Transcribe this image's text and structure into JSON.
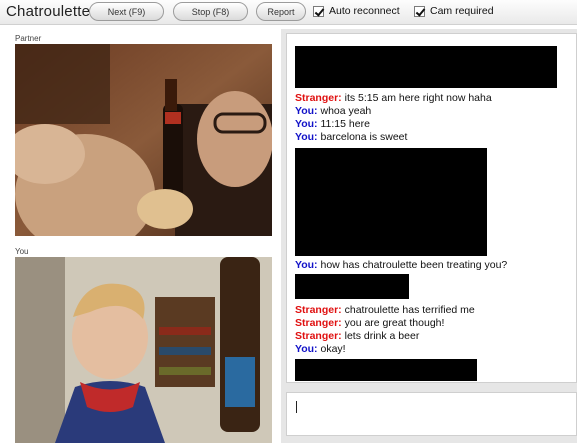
{
  "app": {
    "title": "Chatroulette"
  },
  "toolbar": {
    "next_label": "Next (F9)",
    "stop_label": "Stop (F8)",
    "report_label": "Report",
    "auto_reconnect_label": "Auto reconnect",
    "auto_reconnect_checked": true,
    "cam_required_label": "Cam required",
    "cam_required_checked": true
  },
  "video": {
    "partner_label": "Partner",
    "you_label": "You"
  },
  "chat": {
    "messages": [
      {
        "speaker": "Stranger:",
        "text": " its 5:15 am here right now haha"
      },
      {
        "speaker": "You:",
        "text": " whoa yeah"
      },
      {
        "speaker": "You:",
        "text": " 11:15 here"
      },
      {
        "speaker": "You:",
        "text": " barcelona is sweet"
      },
      {
        "speaker": "You:",
        "text": " how has chatroulette been treating you?"
      },
      {
        "speaker": "Stranger:",
        "text": " chatroulette has terrified me"
      },
      {
        "speaker": "Stranger:",
        "text": " you are great though!"
      },
      {
        "speaker": "Stranger:",
        "text": " lets drink a beer"
      },
      {
        "speaker": "You:",
        "text": " okay!"
      }
    ],
    "input_value": ""
  },
  "colors": {
    "stranger": "#e01010",
    "you": "#1212c8",
    "redaction": "#000000"
  }
}
